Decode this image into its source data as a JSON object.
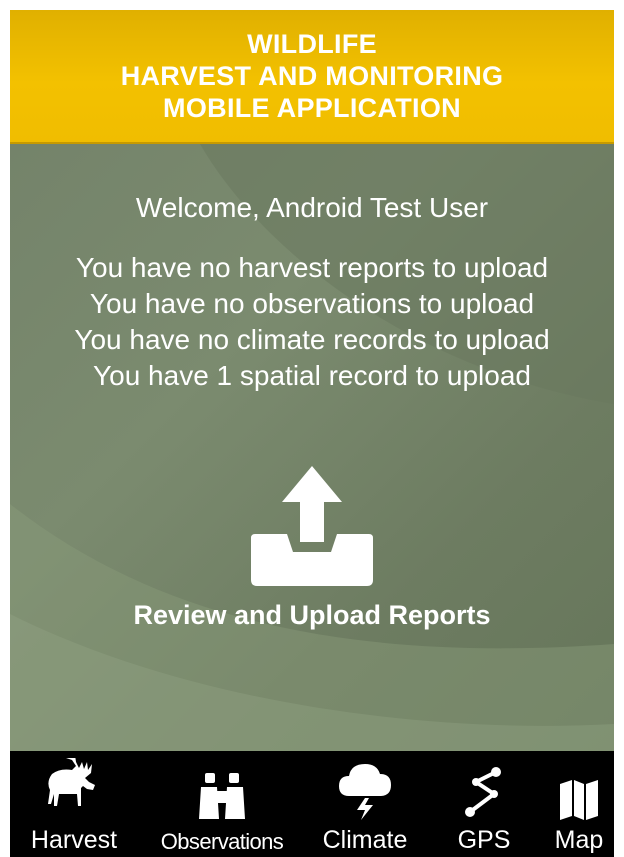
{
  "header": {
    "lines": [
      "WILDLIFE",
      "HARVEST AND MONITORING",
      "MOBILE APPLICATION"
    ]
  },
  "main": {
    "welcome": "Welcome, Android Test User",
    "status_lines": [
      "You have no harvest reports to upload",
      "You have no observations to upload",
      "You have no climate records to upload",
      "You have 1 spatial record to upload"
    ],
    "upload_label": "Review and Upload Reports",
    "upload_icon": "upload-icon"
  },
  "navbar": {
    "items": [
      {
        "label": "Harvest",
        "icon": "moose-icon"
      },
      {
        "label": "Observations",
        "icon": "binoculars-icon"
      },
      {
        "label": "Climate",
        "icon": "storm-cloud-icon"
      },
      {
        "label": "GPS",
        "icon": "route-icon"
      },
      {
        "label": "Map",
        "icon": "map-icon"
      }
    ]
  },
  "colors": {
    "header_bg": "#f3c100",
    "main_bg": "#74836a",
    "navbar_bg": "#000000",
    "text": "#ffffff"
  }
}
